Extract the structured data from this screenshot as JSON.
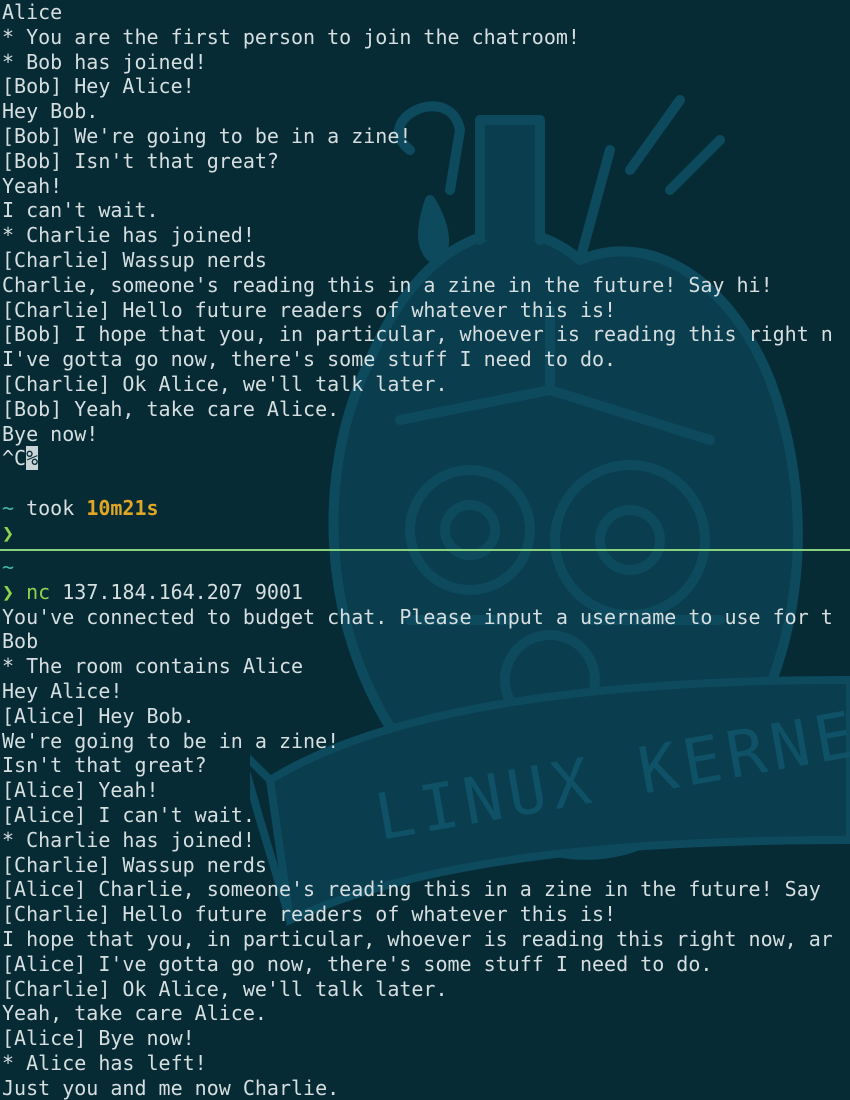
{
  "background_art": {
    "banner_text": "LINUX KERNEL",
    "color": "#0d4a5e",
    "icon": "mechanical-heart-illustration"
  },
  "top_pane": {
    "lines": [
      "Alice",
      "* You are the first person to join the chatroom!",
      "* Bob has joined!",
      "[Bob] Hey Alice!",
      "Hey Bob.",
      "[Bob] We're going to be in a zine!",
      "[Bob] Isn't that great?",
      "Yeah!",
      "I can't wait.",
      "* Charlie has joined!",
      "[Charlie] Wassup nerds",
      "Charlie, someone's reading this in a zine in the future! Say hi!",
      "[Charlie] Hello future readers of whatever this is!",
      "[Bob] I hope that you, in particular, whoever is reading this right n",
      "I've gotta go now, there's some stuff I need to do.",
      "[Charlie] Ok Alice, we'll talk later.",
      "[Bob] Yeah, take care Alice.",
      "Bye now!"
    ],
    "interrupt": "^C",
    "eol_marker": "%",
    "took_tilde": "~",
    "took_label": "took",
    "took_duration": "10m21s",
    "prompt_symbol": "❯"
  },
  "bottom_pane": {
    "cwd": "~",
    "prompt_symbol": "❯",
    "command": "nc",
    "command_args": "137.184.164.207 9001",
    "lines": [
      "You've connected to budget chat. Please input a username to use for t",
      "Bob",
      "* The room contains Alice",
      "Hey Alice!",
      "[Alice] Hey Bob.",
      "We're going to be in a zine!",
      "Isn't that great?",
      "[Alice] Yeah!",
      "[Alice] I can't wait.",
      "* Charlie has joined!",
      "[Charlie] Wassup nerds",
      "[Alice] Charlie, someone's reading this in a zine in the future! Say",
      "[Charlie] Hello future readers of whatever this is!",
      "I hope that you, in particular, whoever is reading this right now, ar",
      "[Alice] I've gotta go now, there's some stuff I need to do.",
      "[Charlie] Ok Alice, we'll talk later.",
      "Yeah, take care Alice.",
      "[Alice] Bye now!",
      "* Alice has left!",
      "Just you and me now Charlie."
    ]
  },
  "colors": {
    "background": "#062b35",
    "text": "#d6dee0",
    "prompt_green": "#8ed44f",
    "tilde_teal": "#3fb8a6",
    "duration_yellow": "#e0a624",
    "divider": "#86d27f"
  }
}
